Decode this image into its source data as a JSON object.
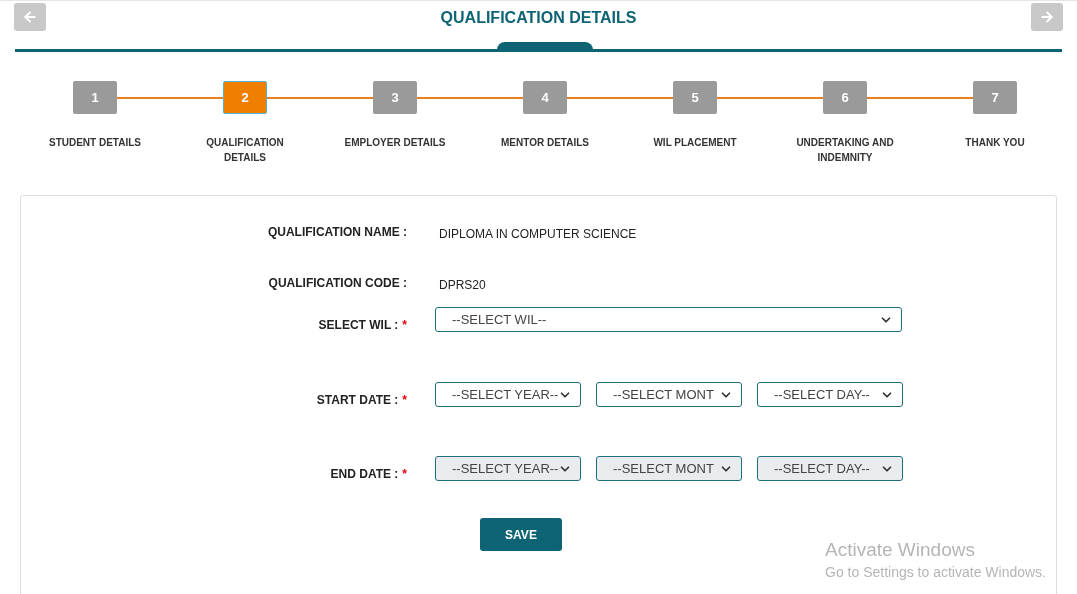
{
  "header": {
    "title": "QUALIFICATION DETAILS",
    "back_disabled": true,
    "forward_disabled": true
  },
  "steps": [
    {
      "number": "1",
      "label": "STUDENT DETAILS",
      "selected": false
    },
    {
      "number": "2",
      "label": "QUALIFICATION DETAILS",
      "selected": true
    },
    {
      "number": "3",
      "label": "EMPLOYER DETAILS",
      "selected": false
    },
    {
      "number": "4",
      "label": "MENTOR DETAILS",
      "selected": false
    },
    {
      "number": "5",
      "label": "WIL PLACEMENT",
      "selected": false
    },
    {
      "number": "6",
      "label": "UNDERTAKING AND INDEMNITY",
      "selected": false
    },
    {
      "number": "7",
      "label": "THANK YOU",
      "selected": false
    }
  ],
  "form": {
    "rows": [
      {
        "kind": "text",
        "label": "QUALIFICATION NAME :",
        "value": "DIPLOMA IN COMPUTER SCIENCE"
      },
      {
        "kind": "text",
        "label": "QUALIFICATION CODE :",
        "value": "DPRS20"
      },
      {
        "kind": "select",
        "label": "SELECT WIL :",
        "required_mark": "*",
        "selects": [
          {
            "value": "--SELECT WIL--",
            "disabled": false
          }
        ]
      },
      {
        "kind": "select",
        "label": "START DATE :",
        "required_mark": "*",
        "selects": [
          {
            "value": "--SELECT YEAR--",
            "disabled": false
          },
          {
            "value": "--SELECT MONT",
            "disabled": false
          },
          {
            "value": "--SELECT DAY--",
            "disabled": false
          }
        ]
      },
      {
        "kind": "select",
        "label": "END DATE :",
        "required_mark": "*",
        "selects": [
          {
            "value": "--SELECT YEAR--",
            "disabled": true
          },
          {
            "value": "--SELECT MONT",
            "disabled": true
          },
          {
            "value": "--SELECT DAY--",
            "disabled": true
          }
        ]
      }
    ],
    "save_button": "SAVE"
  },
  "activation_notice": {
    "title": "Activate Windows",
    "text": "Go to Settings to activate Windows."
  }
}
